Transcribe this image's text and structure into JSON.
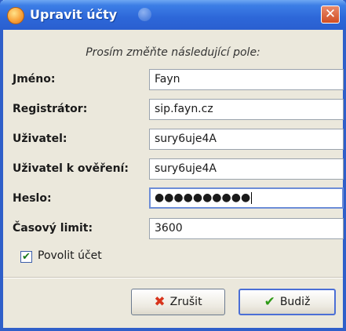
{
  "window": {
    "title": "Upravit účty",
    "close_glyph": "✕"
  },
  "form": {
    "instruction": "Prosím změňte následující pole:",
    "fields": [
      {
        "label": "Jméno:",
        "value": "Fayn"
      },
      {
        "label": "Registrátor:",
        "value": "sip.fayn.cz"
      },
      {
        "label": "Uživatel:",
        "value": "sury6uje4A"
      },
      {
        "label": "Uživatel k ověření:",
        "value": "sury6uje4A"
      },
      {
        "label": "Heslo:",
        "value": "●●●●●●●●●●"
      },
      {
        "label": "Časový limit:",
        "value": "3600"
      }
    ],
    "enable_account": {
      "label": "Povolit účet",
      "checked": true,
      "glyph": "✔"
    }
  },
  "buttons": {
    "cancel": {
      "label": "Zrušit",
      "icon": "x-icon",
      "glyph": "✖"
    },
    "ok": {
      "label": "Budiž",
      "icon": "checkmark-icon",
      "glyph": "✔"
    }
  },
  "colors": {
    "titlebar": "#2d67d8",
    "window_bg": "#ebe8dc",
    "cancel_icon": "#d8341c",
    "ok_icon": "#2e9a16"
  }
}
